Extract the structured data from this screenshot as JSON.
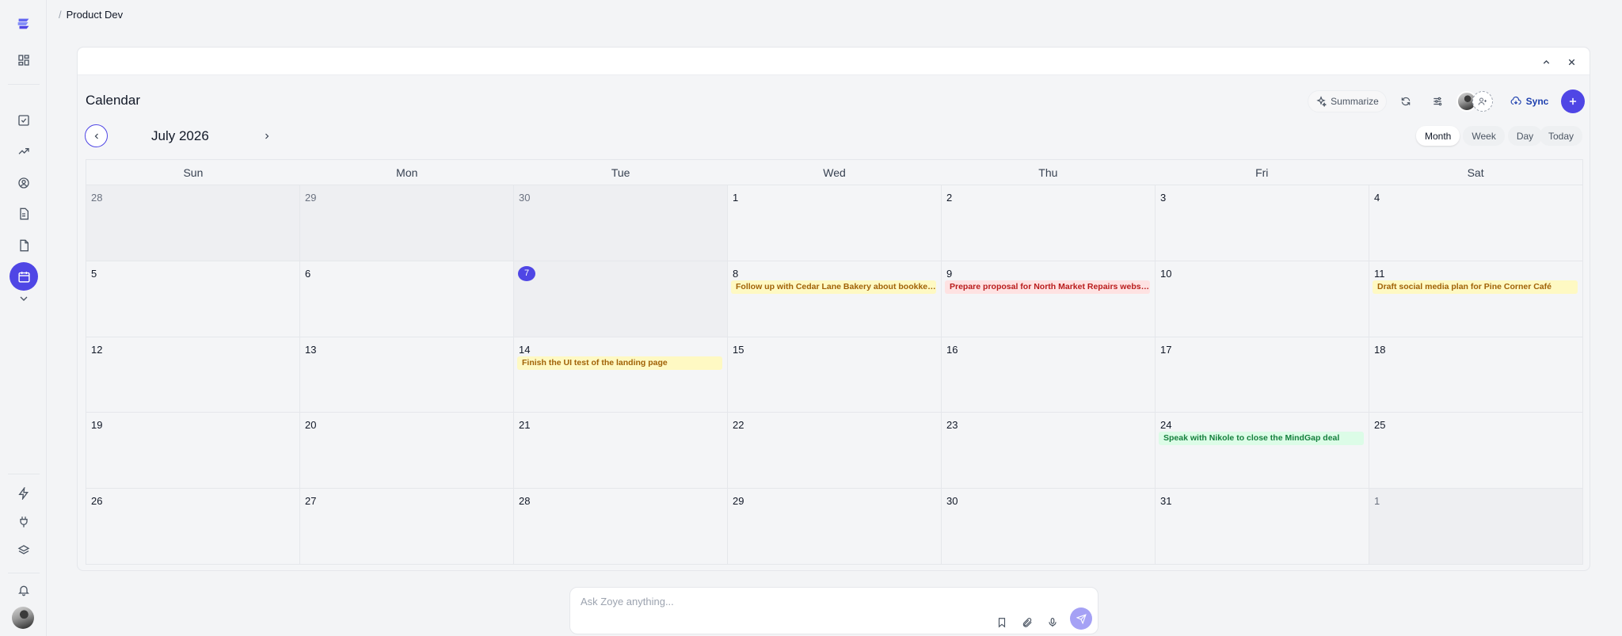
{
  "breadcrumb": {
    "separator": "/",
    "current": "Product Dev"
  },
  "calendar": {
    "title": "Calendar",
    "month_label": "July 2026",
    "toolbar": {
      "summarize_label": "Summarize",
      "sync_label": "Sync"
    },
    "views": [
      "Month",
      "Week",
      "Day"
    ],
    "active_view": "Month",
    "today_label": "Today",
    "weekdays": [
      "Sun",
      "Mon",
      "Tue",
      "Wed",
      "Thu",
      "Fri",
      "Sat"
    ],
    "weeks": [
      [
        {
          "day": "28",
          "other": true
        },
        {
          "day": "29",
          "other": true
        },
        {
          "day": "30",
          "other": true
        },
        {
          "day": "1"
        },
        {
          "day": "2"
        },
        {
          "day": "3"
        },
        {
          "day": "4"
        }
      ],
      [
        {
          "day": "5"
        },
        {
          "day": "6"
        },
        {
          "day": "7",
          "today": true
        },
        {
          "day": "8",
          "event": {
            "text": "Follow up with Cedar Lane Bakery about bookkeep...",
            "color": "yellow"
          }
        },
        {
          "day": "9",
          "event": {
            "text": "Prepare proposal for North Market Repairs website...",
            "color": "red"
          }
        },
        {
          "day": "10"
        },
        {
          "day": "11",
          "event": {
            "text": "Draft social media plan for Pine Corner Café",
            "color": "yellow"
          }
        }
      ],
      [
        {
          "day": "12"
        },
        {
          "day": "13"
        },
        {
          "day": "14",
          "event": {
            "text": "Finish the UI test of the landing page",
            "color": "yellow"
          }
        },
        {
          "day": "15"
        },
        {
          "day": "16"
        },
        {
          "day": "17"
        },
        {
          "day": "18"
        }
      ],
      [
        {
          "day": "19"
        },
        {
          "day": "20"
        },
        {
          "day": "21"
        },
        {
          "day": "22"
        },
        {
          "day": "23"
        },
        {
          "day": "24",
          "event": {
            "text": "Speak with Nikole to close the MindGap deal",
            "color": "green"
          }
        },
        {
          "day": "25"
        }
      ],
      [
        {
          "day": "26"
        },
        {
          "day": "27"
        },
        {
          "day": "28"
        },
        {
          "day": "29"
        },
        {
          "day": "30"
        },
        {
          "day": "31"
        },
        {
          "day": "1",
          "other": true
        }
      ]
    ]
  },
  "ask": {
    "placeholder": "Ask Zoye anything..."
  },
  "colors": {
    "accent": "#4f46e5",
    "event_yellow": "#a16207",
    "event_red": "#b91c1c",
    "event_green": "#15803d"
  },
  "icons": {
    "rail": [
      "logo-icon",
      "dashboard-icon",
      "tasks-icon",
      "trending-icon",
      "contacts-icon",
      "document-icon",
      "file-icon",
      "calendar-icon",
      "chevron-down-icon",
      "lightning-icon",
      "plug-icon",
      "layers-icon",
      "bell-icon"
    ]
  }
}
